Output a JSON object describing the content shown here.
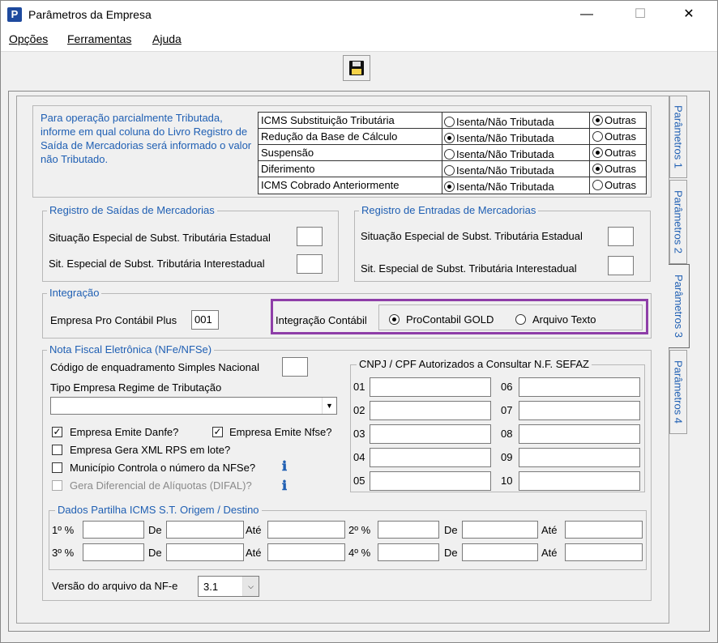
{
  "window": {
    "title": "Parâmetros da Empresa",
    "minimize": "—",
    "maximize": "☐",
    "close": "✕"
  },
  "menu": {
    "items": [
      {
        "label": "Opções"
      },
      {
        "label": "Ferramentas"
      },
      {
        "label": "Ajuda"
      }
    ]
  },
  "tabs": [
    "Parâmetros 1",
    "Parâmetros 2",
    "Parâmetros 3",
    "Parâmetros 4"
  ],
  "intro_text": "Para operação parcialmente Tributada, informe em qual coluna do Livro Registro de Saída de Mercadorias será informado o valor não Tributado.",
  "tax_table": {
    "option_a": "Isenta/Não Tributada",
    "option_b": "Outras",
    "rows": [
      {
        "name": "ICMS Substituição Tributária",
        "selected": "b"
      },
      {
        "name": "Redução da Base de Cálculo",
        "selected": "a"
      },
      {
        "name": "Suspensão",
        "selected": "b"
      },
      {
        "name": "Diferimento",
        "selected": "b"
      },
      {
        "name": "ICMS Cobrado Anteriormente",
        "selected": "a"
      }
    ]
  },
  "saidas": {
    "title": "Registro de Saídas de Mercadorias",
    "estadual": "Situação Especial de Subst. Tributária Estadual",
    "interestadual": "Sit. Especial de Subst. Tributária Interestadual"
  },
  "entradas": {
    "title": "Registro de Entradas de Mercadorias",
    "estadual": "Situação Especial de Subst. Tributária Estadual",
    "interestadual": "Sit. Especial de Subst. Tributária Interestadual"
  },
  "integracao": {
    "title": "Integração",
    "empresa_label": "Empresa Pro Contábil Plus",
    "empresa_value": "001",
    "contabil_label": "Integração Contábil",
    "opt1": "ProContabil GOLD",
    "opt2": "Arquivo Texto",
    "highlight_color": "#8e3ea8"
  },
  "nfe": {
    "title": "Nota Fiscal Eletrônica (NFe/NFSe)",
    "codigo_label": "Código de enquadramento Simples Nacional",
    "tipo_label": "Tipo Empresa Regime de Tributação",
    "danfe": "Empresa Emite Danfe?",
    "nfse": "Empresa Emite Nfse?",
    "xml": "Empresa Gera XML RPS em lote?",
    "municipio": "Município Controla o número da NFSe?",
    "difal": "Gera Diferencial de Alíquotas (DIFAL)?",
    "cnpj_title": "CNPJ / CPF Autorizados a Consultar N.F. SEFAZ",
    "cnpj_left": [
      "01",
      "02",
      "03",
      "04",
      "05"
    ],
    "cnpj_right": [
      "06",
      "07",
      "08",
      "09",
      "10"
    ]
  },
  "partilha": {
    "title": "Dados Partilha ICMS S.T. Origem / Destino",
    "p1": "1º %",
    "p2": "2º %",
    "p3": "3º %",
    "p4": "4º %",
    "de": "De",
    "ate": "Até"
  },
  "versao": {
    "label": "Versão do arquivo da NF-e",
    "value": "3.1"
  }
}
